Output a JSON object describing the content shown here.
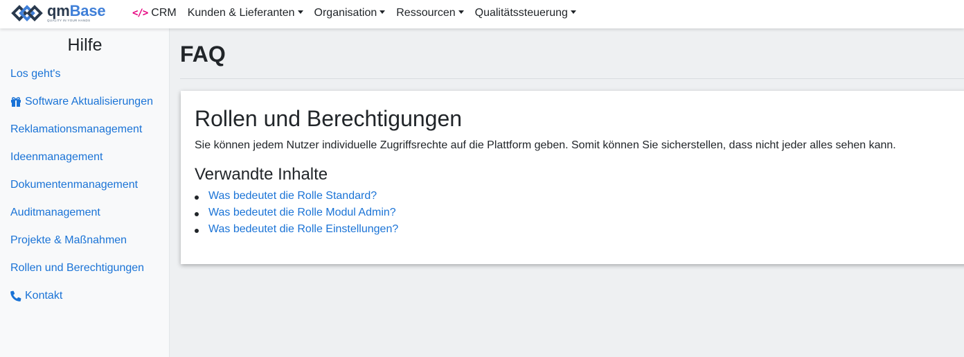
{
  "brand": {
    "name_part1": "qm",
    "name_part2": "Base",
    "tagline": "QUALITY IN YOUR HANDS",
    "logo_icon": "qmbase-logo-icon",
    "color_dark": "#2a3a4e",
    "color_accent": "#3f7fd8"
  },
  "nav": {
    "crm": {
      "label": "CRM",
      "icon": "code-icon",
      "icon_glyph": "</>",
      "icon_color": "#e6007e"
    },
    "items": [
      {
        "label": "Kunden & Lieferanten",
        "dropdown": true
      },
      {
        "label": "Organisation",
        "dropdown": true
      },
      {
        "label": "Ressourcen",
        "dropdown": true
      },
      {
        "label": "Qualitätssteuerung",
        "dropdown": true
      }
    ]
  },
  "sidebar": {
    "title": "Hilfe",
    "link_color": "#1a73d6",
    "items": [
      {
        "label": "Los geht's",
        "icon": null
      },
      {
        "label": "Software Aktualisierungen",
        "icon": "gift-icon"
      },
      {
        "label": "Reklamationsmanagement",
        "icon": null
      },
      {
        "label": "Ideenmanagement",
        "icon": null
      },
      {
        "label": "Dokumentenmanagement",
        "icon": null
      },
      {
        "label": "Auditmanagement",
        "icon": null
      },
      {
        "label": "Projekte & Maßnahmen",
        "icon": null
      },
      {
        "label": "Rollen und Berechtigungen",
        "icon": null
      },
      {
        "label": "Kontakt",
        "icon": "phone-icon"
      }
    ]
  },
  "main": {
    "page_title": "FAQ",
    "card": {
      "title": "Rollen und Berechtigungen",
      "text": "Sie können jedem Nutzer individuelle Zugriffsrechte auf die Plattform geben. Somit können Sie sicherstellen, dass nicht jeder alles sehen kann.",
      "related_title": "Verwandte Inhalte",
      "related": [
        "Was bedeutet die Rolle Standard?",
        "Was bedeutet die Rolle Modul Admin?",
        "Was bedeutet die Rolle Einstellungen?"
      ]
    }
  }
}
